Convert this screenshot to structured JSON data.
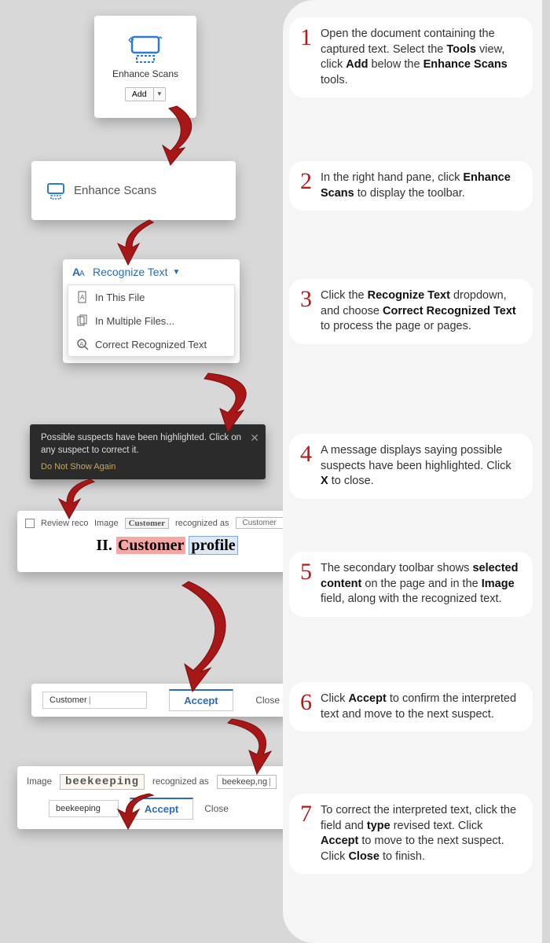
{
  "steps": {
    "1": [
      "Open the document containing the captured text. Select the ",
      "Tools",
      " view, click ",
      "Add",
      " below the ",
      "Enhance Scans",
      " tools."
    ],
    "2": [
      "In the right hand pane, click ",
      "Enhance Scans",
      " to display the toolbar."
    ],
    "3": [
      "Click the ",
      "Recognize Text",
      " dropdown, and choose ",
      "Correct Recognized Text",
      " to process the page or pages."
    ],
    "4": [
      "A message displays saying possible suspects have been highlighted. Click ",
      "X",
      " to close."
    ],
    "5": [
      "The secondary toolbar shows ",
      "selected content",
      " on the page and in the ",
      "Image",
      " field, along with the recognized text."
    ],
    "6": [
      "Click ",
      "Accept",
      " to confirm the interpreted text and move to the next suspect."
    ],
    "7": [
      "To correct the interpreted text, click the field and ",
      "type",
      " revised text. Click ",
      "Accept",
      " to move to the next suspect. Click ",
      "Close",
      " to finish."
    ]
  },
  "ui": {
    "enhance_scans_label": "Enhance Scans",
    "add_label": "Add",
    "recognize_text_label": "Recognize Text",
    "menu_in_this_file": "In This File",
    "menu_in_multiple": "In Multiple Files...",
    "menu_correct": "Correct Recognized Text",
    "toast_msg": "Possible suspects have been highlighted. Click on any suspect to correct it.",
    "toast_dnsa": "Do Not Show Again",
    "review_checkbox_label": "Review recognized text",
    "image_label": "Image",
    "recognized_as_label": "recognized as",
    "customer_word": "Customer",
    "customer_rec": "Customer",
    "profile_prefix": "II.",
    "profile_w1": "Customer",
    "profile_w2": "profile",
    "accept_label": "Accept",
    "close_label": "Close",
    "customer_field": "Customer",
    "beek_img": "beekeeping",
    "beek_rec": "beekeep,ng",
    "beek_fixed": "beekeeping"
  }
}
